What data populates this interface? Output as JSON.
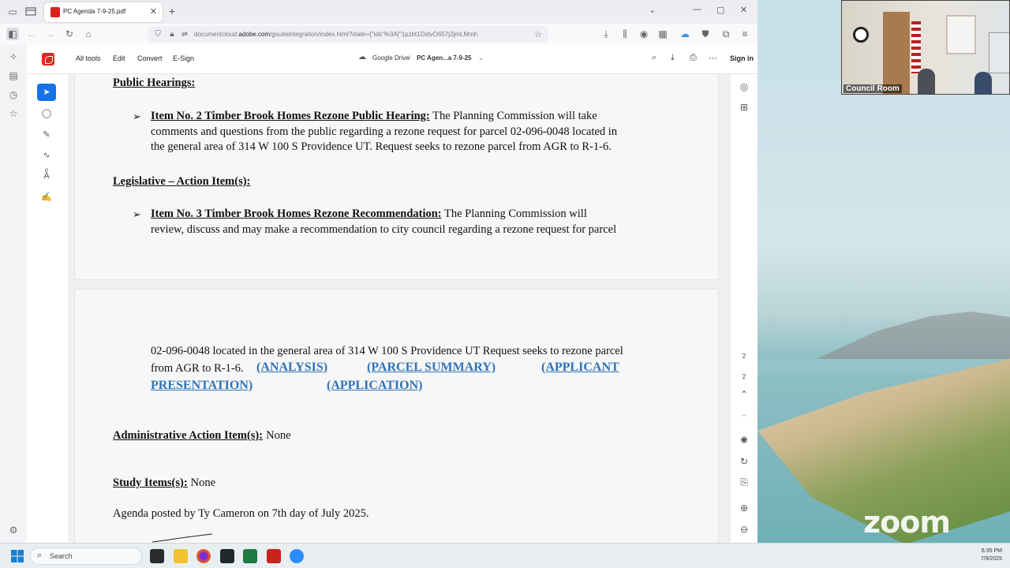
{
  "browser": {
    "tab_title": "PC Agenda 7-9-25.pdf",
    "url_prefix": "documentcloud.",
    "url_domain": "adobe.com",
    "url_rest": "/gsuiteintegration/index.html?state={\"ids\"%3A[\"1pzbt1DstvO657j2jmLMmh"
  },
  "acrobat": {
    "menu": {
      "all_tools": "All tools",
      "edit": "Edit",
      "convert": "Convert",
      "esign": "E-Sign"
    },
    "breadcrumb": {
      "drive": "Google Drive",
      "separator": "/",
      "file": "PC Agen...a 7-9-25"
    },
    "sign_in": "Sign in",
    "page_indicator": {
      "current": "2",
      "total": "2"
    }
  },
  "document": {
    "public_hearings_heading": "Public Hearings:",
    "item2": {
      "label": "Item No.   2    Timber Brook Homes Rezone Public Hearing:",
      "text_line1": " The Planning Commission will take",
      "text_line2": "comments and questions from the public regarding a rezone request for parcel 02-096-0048 located in",
      "text_line3": "the general area of 314 W 100 S Providence UT. Request seeks to rezone parcel from AGR to R-1-6."
    },
    "legislative_heading": "Legislative – Action Item(s):",
    "item3": {
      "label": "Item No.   3    Timber Brook Homes Rezone Recommendation:",
      "text_line1": " The Planning Commission will",
      "text_line2": "review, discuss and may make a recommendation to city council regarding a rezone request for parcel"
    },
    "page2": {
      "cont_line1": "02-096-0048 located in the general area of 314 W 100 S Providence UT Request seeks to rezone parcel",
      "cont_line2_text": "from AGR to R-1-6. ",
      "links": {
        "analysis": "(ANALYSIS)",
        "parcel_summary": "(PARCEL SUMMARY)",
        "applicant": "(APPLICANT",
        "presentation": "PRESENTATION)",
        "application": "(APPLICATION)"
      },
      "admin_heading": "Administrative Action Item(s):",
      "admin_value": "None",
      "study_heading": "Study Items(s):",
      "study_value": "None",
      "posted_line": "Agenda posted by Ty Cameron  on    7th  day of   July  2025."
    }
  },
  "zoom": {
    "participant_label": "Council Room",
    "logo": "zoom"
  },
  "taskbar": {
    "search_placeholder": "Search",
    "time": "6:35 PM",
    "date": "7/9/2025"
  },
  "colors": {
    "accent": "#1473e6",
    "acrobat_red": "#e0281d",
    "link_blue": "#2f73b8"
  }
}
